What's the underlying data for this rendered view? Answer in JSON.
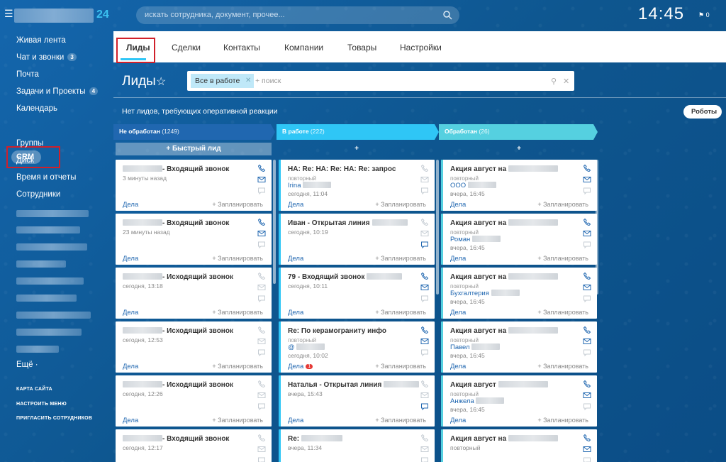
{
  "header": {
    "logo_suffix": "24",
    "search_placeholder": "искать сотрудника, документ, прочее...",
    "clock": "14:45",
    "notifications": "0"
  },
  "sidebar": {
    "items": [
      {
        "label": "Живая лента"
      },
      {
        "label": "Чат и звонки",
        "count": "3"
      },
      {
        "label": "Почта"
      },
      {
        "label": "Задачи и Проекты",
        "count": "4"
      },
      {
        "label": "Календарь"
      },
      {
        "label": "CRM"
      },
      {
        "label": "Группы"
      },
      {
        "label": "Диск"
      },
      {
        "label": "Время и отчеты"
      },
      {
        "label": "Сотрудники"
      }
    ],
    "more": "Ещё ·",
    "sitemap": "КАРТА САЙТА",
    "configure": "НАСТРОИТЬ МЕНЮ",
    "invite": "ПРИГЛАСИТЬ СОТРУДНИКОВ"
  },
  "tabs": [
    "Лиды",
    "Сделки",
    "Контакты",
    "Компании",
    "Товары",
    "Настройки"
  ],
  "page": {
    "title": "Лиды",
    "filter_chip": "Все в работе",
    "filter_placeholder": "+ поиск",
    "notice": "Нет лидов, требующих оперативной реакции",
    "robots": "Роботы"
  },
  "columns": [
    {
      "name": "Не обработан",
      "count": "(1249)",
      "color": "#2067b0",
      "quick": "+ Быстрый лид"
    },
    {
      "name": "В работе",
      "count": "(222)",
      "color": "#2fc6f6",
      "quick": "+"
    },
    {
      "name": "Обработан",
      "count": "(26)",
      "color": "#55d0e0",
      "quick": "+"
    }
  ],
  "card_common": {
    "dela": "Дела",
    "plan": "+ Запланировать"
  },
  "cards": [
    [
      {
        "title": "- Входящий звонок",
        "l2": "3 минуты назад"
      },
      {
        "title": "- Входящий звонок",
        "l2": "23 минуты назад"
      },
      {
        "title": "- Исходящий звонок",
        "l2": "сегодня, 13:18"
      },
      {
        "title": "- Исходящий звонок",
        "l2": "сегодня, 12:53"
      },
      {
        "title": "- Исходящий звонок",
        "l2": "сегодня, 12:26"
      },
      {
        "title": "- Входящий звонок",
        "l2": "сегодня, 12:17"
      }
    ],
    [
      {
        "title": "НА: Re: НА: Re: НА: Re: запрос",
        "l2": "повторный",
        "l3": "Irina",
        "l4": "сегодня, 11:04"
      },
      {
        "title": "Иван - Открытая линия",
        "l2": "сегодня, 10:19"
      },
      {
        "title": "79 - Входящий звонок",
        "l2": "сегодня, 10:11"
      },
      {
        "title": "Re: По керамограниту инфо",
        "l2": "повторный",
        "l3": "@",
        "l4": "сегодня, 10:02",
        "badge": "1"
      },
      {
        "title": "Наталья - Открытая линия",
        "l2": "вчера, 15:43"
      },
      {
        "title": "Re:",
        "l2": "вчера, 11:34"
      }
    ],
    [
      {
        "title": "Акция август на",
        "l2": "повторный",
        "l3": "ООО",
        "l4": "вчера, 16:45"
      },
      {
        "title": "Акция август на",
        "l2": "повторный",
        "l3": "Роман",
        "l4": "вчера, 16:45"
      },
      {
        "title": "Акция август на",
        "l2": "повторный",
        "l3": "Бухгалтерия",
        "l4": "вчера, 16:45"
      },
      {
        "title": "Акция август на",
        "l2": "повторный",
        "l3": "Павел",
        "l4": "вчера, 16:45"
      },
      {
        "title": "Акция август",
        "l2": "повторный",
        "l3": "Анжела",
        "l4": "вчера, 16:45"
      },
      {
        "title": "Акция август на",
        "l2": "повторный"
      }
    ]
  ]
}
